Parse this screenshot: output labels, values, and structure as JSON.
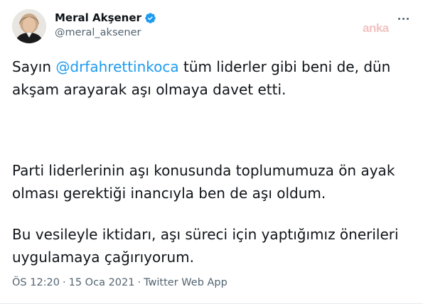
{
  "author": {
    "display_name": "Meral Akşener",
    "handle": "@meral_aksener",
    "verified": true,
    "avatar": "profile-photo"
  },
  "watermark": "anka",
  "tweet": {
    "p1_prefix": "Sayın ",
    "p1_mention": "@drfahrettinkoca",
    "p1_line1_suffix": " tüm liderler gibi beni de, dün",
    "p1_line2": "akşam arayarak aşı olmaya davet etti.",
    "p2_line1": "Parti liderlerinin aşı konusunda toplumumuza ön ayak",
    "p2_line2": "olması gerektiği inancıyla ben de aşı oldum.",
    "p3_line1": "Bu vesileyle iktidarı, aşı süreci için yaptığımız önerileri",
    "p3_line2": "uygulamaya çağırıyorum."
  },
  "meta": {
    "time": "ÖS 12:20",
    "date": "15 Oca 2021",
    "separator": "·",
    "source": "Twitter Web App"
  },
  "colors": {
    "text": "#0f1419",
    "muted": "#536471",
    "link": "#1d9bf0",
    "verified": "#1d9bf0",
    "watermark": "#f0b8b8"
  }
}
